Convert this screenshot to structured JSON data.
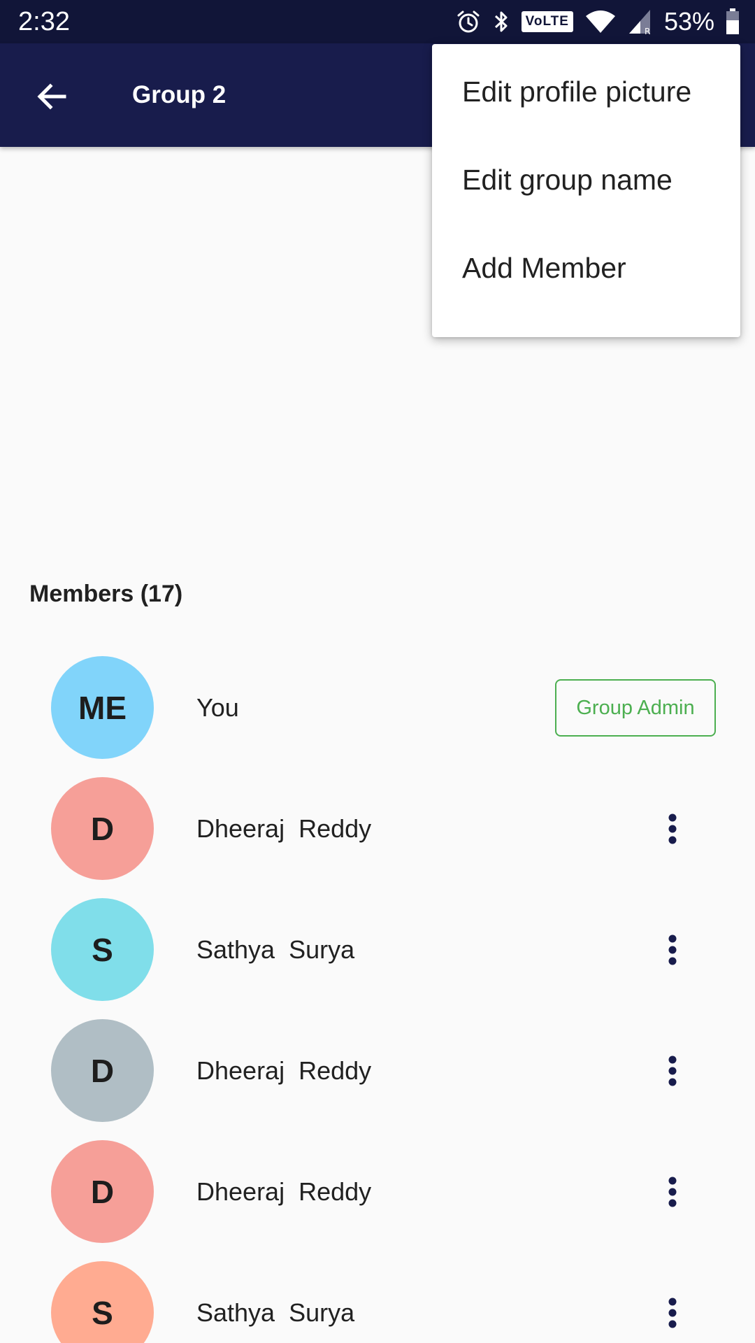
{
  "status_bar": {
    "time": "2:32",
    "volte": "VoLTE",
    "battery": "53%",
    "icons": [
      "alarm-icon",
      "bluetooth-icon",
      "volte-icon",
      "wifi-icon",
      "signal-icon",
      "battery-icon"
    ]
  },
  "app_bar": {
    "title": "Group 2",
    "back_icon": "back-arrow-icon"
  },
  "members": {
    "header": "Members (17)",
    "admin_badge": "Group Admin",
    "items": [
      {
        "initials": "ME",
        "name": "You",
        "color": "#81d4fa",
        "role": "admin"
      },
      {
        "initials": "D",
        "name": "Dheeraj  Reddy",
        "color": "#f69f98",
        "role": "member"
      },
      {
        "initials": "S",
        "name": "Sathya  Surya",
        "color": "#80deea",
        "role": "member"
      },
      {
        "initials": "D",
        "name": "Dheeraj  Reddy",
        "color": "#b0bec5",
        "role": "member"
      },
      {
        "initials": "D",
        "name": "Dheeraj  Reddy",
        "color": "#f69f98",
        "role": "member"
      },
      {
        "initials": "S",
        "name": "Sathya  Surya",
        "color": "#ffab91",
        "role": "member"
      }
    ]
  },
  "menu": {
    "items": [
      "Edit profile picture",
      "Edit group name",
      "Add Member"
    ]
  },
  "colors": {
    "status_bar": "#111538",
    "app_bar": "#181c4c",
    "background": "#fafafa",
    "admin_accent": "#4caf50",
    "more_icon": "#181c4c"
  }
}
